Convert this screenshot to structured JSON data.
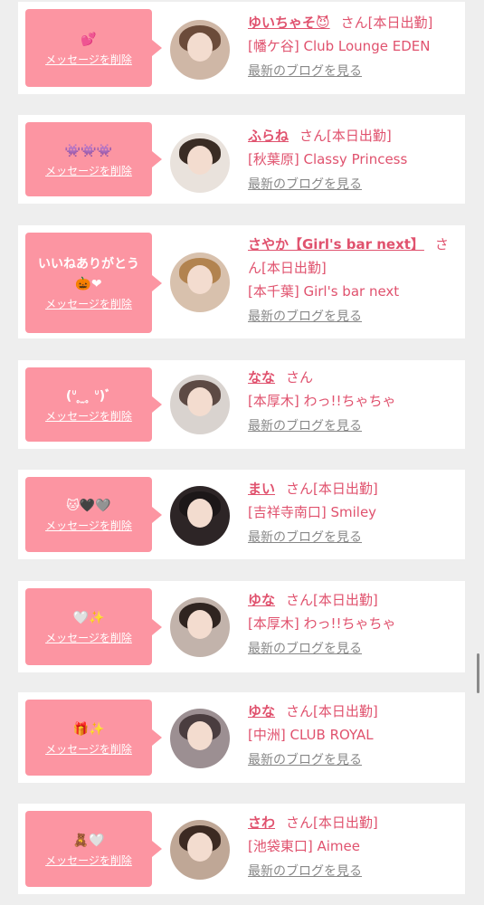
{
  "delete_label": "メッセージを削除",
  "blog_label": "最新のブログを見る",
  "san_label": "さん",
  "colors": {
    "bubble": "#fc95a2",
    "accent": "#e0526e",
    "muted": "#888888"
  },
  "entries": [
    {
      "message": "💕",
      "name": "ゆいちゃそ😈",
      "status": "[本日出勤]",
      "shop": "[幡ケ谷] Club Lounge EDEN",
      "avatar_icon": "profile-photo-icon"
    },
    {
      "message": "👾👾👾",
      "name": "ふらね",
      "status": "[本日出勤]",
      "shop": "[秋葉原] Classy Princess",
      "avatar_icon": "profile-photo-icon"
    },
    {
      "message": "いいねありがとう🎃❤",
      "name": "さやか【Girl's bar next】",
      "status": "[本日出勤]",
      "shop": "[本千葉] Girl's bar next",
      "avatar_icon": "profile-photo-icon"
    },
    {
      "message": "(ᐡ ̥ ̫ ̥ ᐡ)ﾞ",
      "name": "なな",
      "status": "",
      "shop": "[本厚木] わっ!!ちゃちゃ",
      "avatar_icon": "profile-photo-icon"
    },
    {
      "message": "🐱🖤🩶",
      "name": "まい",
      "status": "[本日出勤]",
      "shop": "[吉祥寺南口] Smiley",
      "avatar_icon": "profile-photo-icon"
    },
    {
      "message": "🤍✨",
      "name": "ゆな",
      "status": "[本日出勤]",
      "shop": "[本厚木] わっ!!ちゃちゃ",
      "avatar_icon": "profile-photo-icon"
    },
    {
      "message": "🎁✨",
      "name": "ゆな",
      "status": "[本日出勤]",
      "shop": "[中洲] CLUB ROYAL",
      "avatar_icon": "profile-photo-icon"
    },
    {
      "message": "🧸🤍",
      "name": "さわ",
      "status": "[本日出勤]",
      "shop": "[池袋東口] Aimee",
      "avatar_icon": "profile-photo-icon"
    }
  ]
}
